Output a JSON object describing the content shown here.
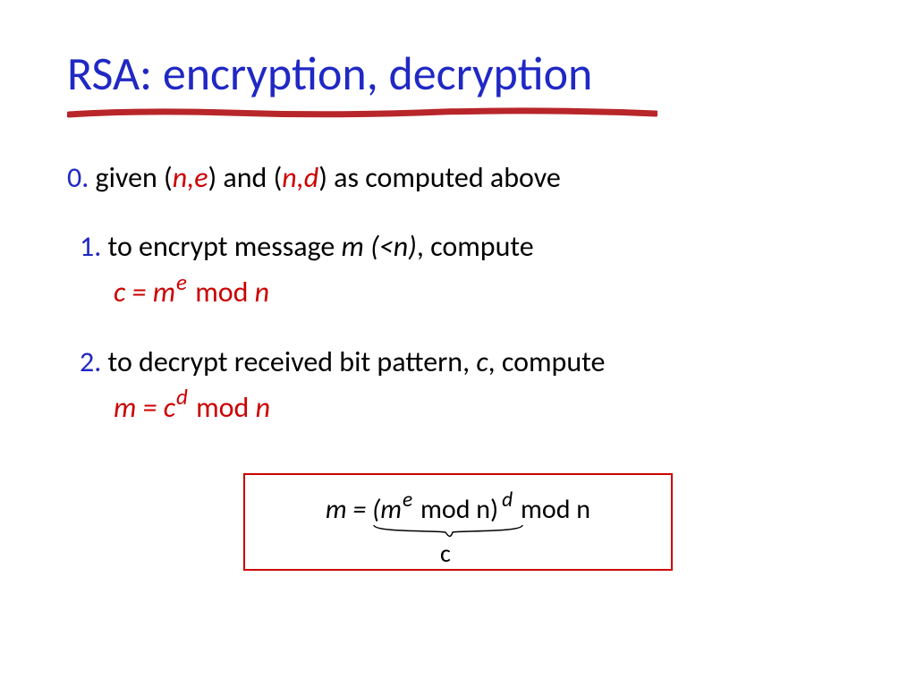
{
  "title": "RSA: encryption, decryption",
  "step0": {
    "num": "0.",
    "pre": "  given (",
    "k1": "n,e",
    "mid": ") and (",
    "k2": "n,d",
    "post": ") as computed above"
  },
  "step1": {
    "num": "1.",
    "text_a": " to encrypt message ",
    "m": "m (<n)",
    "text_b": ", compute",
    "formula_c": "c = m",
    "formula_e": "e",
    "formula_mod": " mod  ",
    "formula_n": "n"
  },
  "step2": {
    "num": "2.",
    "text_a": " to decrypt received bit pattern, ",
    "c": "c",
    "text_b": ", compute",
    "formula_m": "m = c",
    "formula_d": "d",
    "formula_mod": " mod  ",
    "formula_n": "n"
  },
  "box": {
    "p1": "m  =  (m",
    "e": "e",
    "p2": " mod  n)",
    "d": "d",
    "p3": " mod  n",
    "c": "c"
  }
}
